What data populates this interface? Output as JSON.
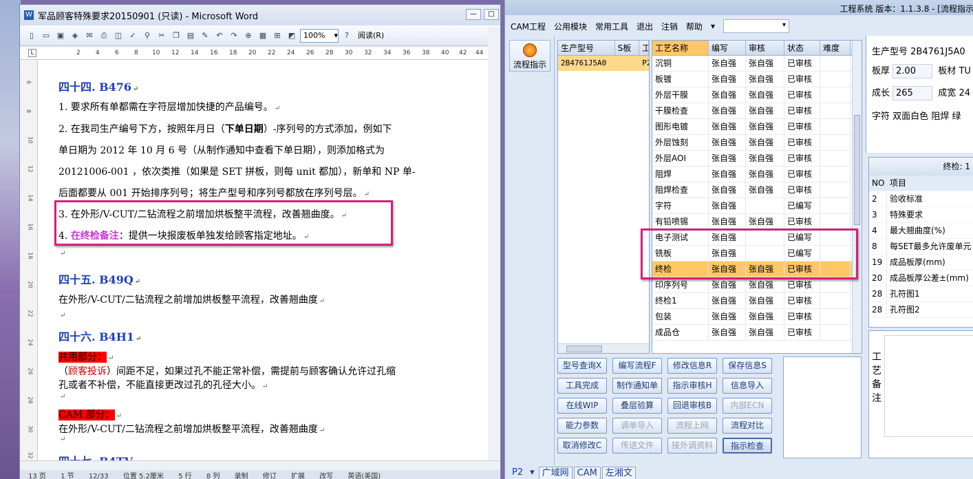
{
  "word": {
    "title": "军品顾客特殊要求20150901 (只读) - Microsoft Word",
    "zoom": "100%",
    "read_label": "阅读(R)",
    "ruler_nums": [
      "2",
      "4",
      "6",
      "8",
      "10",
      "12",
      "14",
      "16",
      "18",
      "20",
      "22",
      "24",
      "26",
      "28",
      "30",
      "32",
      "34",
      "36",
      "38",
      "40",
      "42",
      "44",
      "46"
    ],
    "vruler_nums": [
      "6",
      "8",
      "10",
      "12",
      "14",
      "16",
      "18",
      "20",
      "22",
      "24",
      "26",
      "28",
      "30",
      "32"
    ],
    "h44": "四十四. B476",
    "p1": "1. 要求所有单都需在字符层增加快捷的产品编号。",
    "p2a": "2. 在我司生产编号下方，按照年月日（",
    "p2bold": "下单日期",
    "p2b": "）-序列号的方式添加，例如下",
    "p2c": "单日期为 2012 年 10 月 6 号（从制作通知中查看下单日期），则添加格式为",
    "p2d": "20121006-001 ，依次类推（如果是 SET 拼板，则每 unit 都加），新单和 NP 单-",
    "p2e": "后面都要从 001 开始排序列号；将生产型号和序列号都放在序列号层。",
    "p3": "3. 在外形/V-CUT/二钻流程之前增加烘板整平流程，改善翘曲度。",
    "p4num": "4. ",
    "p4hl": "在终检备注",
    "p4rest": "：提供一块报废板单独发给顾客指定地址。",
    "h45": "四十五. B49Q",
    "p45": "在外形/V-CUT/二钻流程之前增加烘板整平流程，改善翘曲度",
    "h46": "四十六. B4H1",
    "common": "共用部分：",
    "p46a_open": "（",
    "p46a_red": "顾客投诉",
    "p46a_rest": "）间距不足，如果过孔不能正常补偿，需提前与顾客确认允许过孔缩",
    "p46b": "孔或者不补偿，不能直接更改过孔的孔径大小。",
    "cam_part": "CAM 部分：",
    "p46c": "在外形/V-CUT/二钻流程之前增加烘板整平流程，改善翘曲度",
    "h47": "四十七. B4TV",
    "status": [
      "13 页",
      "1 节",
      "12/33",
      "位置 5.2厘米",
      "5 行",
      "8 列",
      "录制",
      "修订",
      "扩展",
      "改写",
      "英语(美国)"
    ]
  },
  "app": {
    "title": "工程系统  版本：1.1.3.8 - [流程指示",
    "menu": [
      "CAM工程",
      "公用模块",
      "常用工具",
      "退出",
      "注销",
      "帮助"
    ],
    "flow_btn": "流程指示",
    "grid_a_headers": [
      "生产型号",
      "S板",
      "工"
    ],
    "grid_a_row": [
      "2B4761J5A0",
      "P2"
    ],
    "grid_b_headers": [
      "工艺名称",
      "编写",
      "审核",
      "状态",
      "难度"
    ],
    "grid_b_rows": [
      [
        "沉铜",
        "张自强",
        "张自强",
        "已审核"
      ],
      [
        "板镀",
        "张自强",
        "张自强",
        "已审核"
      ],
      [
        "外层干膜",
        "张自强",
        "张自强",
        "已审核"
      ],
      [
        "干膜检查",
        "张自强",
        "张自强",
        "已审核"
      ],
      [
        "图形电镀",
        "张自强",
        "张自强",
        "已审核"
      ],
      [
        "外层蚀刻",
        "张自强",
        "张自强",
        "已审核"
      ],
      [
        "外层AOI",
        "张自强",
        "张自强",
        "已审核"
      ],
      [
        "阻焊",
        "张自强",
        "张自强",
        "已审核"
      ],
      [
        "阻焊检查",
        "张自强",
        "张自强",
        "已审核"
      ],
      [
        "字符",
        "张自强",
        "",
        "已编写"
      ],
      [
        "有铅喷锡",
        "张自强",
        "张自强",
        "已审核"
      ],
      [
        "电子测试",
        "张自强",
        "",
        "已编写"
      ],
      [
        "铣板",
        "张自强",
        "",
        "已编写"
      ],
      [
        "终检",
        "张自强",
        "张自强",
        "已审核"
      ],
      [
        "印序列号",
        "张自强",
        "张自强",
        "已审核"
      ],
      [
        "终检1",
        "张自强",
        "张自强",
        "已审核"
      ],
      [
        "包装",
        "张自强",
        "张自强",
        "已审核"
      ],
      [
        "成品仓",
        "张自强",
        "张自强",
        "已审核"
      ]
    ],
    "buttons": [
      [
        "型号查询X",
        "编写流程F",
        "修改信息R",
        "保存信息S"
      ],
      [
        "工具完成",
        "制作通知单",
        "指示审核H",
        "信息导入"
      ],
      [
        "在线WIP",
        "叠层验算",
        "回退审核B",
        "内部ECN"
      ],
      [
        "能力参数",
        "调单导入",
        "流程上网",
        "流程对比"
      ],
      [
        "取消修改C",
        "传送文件",
        "接外调资料",
        "指示检查"
      ]
    ],
    "right": {
      "model_label": "生产型号",
      "model": "2B4761J5A0",
      "thick_label": "板厚",
      "thick": "2.00",
      "mat_label": "板材",
      "mat": "TU",
      "grow_label": "成长",
      "grow": "265",
      "width_label": "成宽",
      "width": "24",
      "char_label": "字符",
      "char": "双面白色",
      "mask_label": "阻焊",
      "mask": "绿"
    },
    "check": {
      "title": "终检: 1",
      "headers": [
        "NO",
        "项目"
      ],
      "rows": [
        [
          "2",
          "验收标准"
        ],
        [
          "3",
          "特殊要求"
        ],
        [
          "4",
          "最大翘曲度(%)"
        ],
        [
          "8",
          "每SET最多允许废单元"
        ],
        [
          "19",
          "成品板厚(mm)"
        ],
        [
          "20",
          "成品板厚公差±(mm)"
        ],
        [
          "28",
          "孔符图1"
        ],
        [
          "28",
          "孔符图2"
        ]
      ]
    },
    "remark_label": "工艺备注",
    "tabs": [
      "P2",
      "广域网",
      "CAM",
      "左湘文"
    ]
  }
}
